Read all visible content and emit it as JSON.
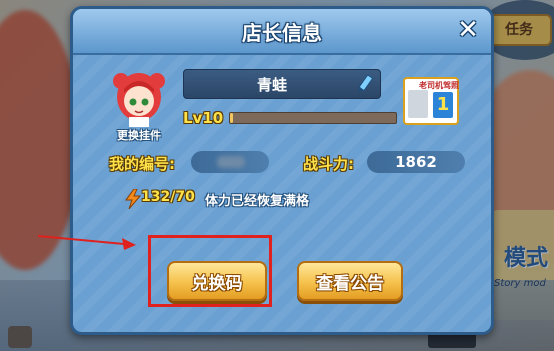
{
  "dialog": {
    "title": "店长信息",
    "close_symbol": "✕"
  },
  "profile": {
    "avatar_icon": "chibi-girl-avatar-icon",
    "change_pendant_label": "更换挂件",
    "name": "青蛙",
    "level_label": "Lv10",
    "xp_progress_fraction": 0.02,
    "license_title": "老司机驾照",
    "license_number": "1"
  },
  "stats": {
    "id_label": "我的编号:",
    "power_label": "战斗力:",
    "power_value": "1862",
    "stamina_value": "132/70",
    "stamina_status": "体力已经恢复满格"
  },
  "buttons": {
    "redeem_label": "兑换码",
    "notice_label": "查看公告"
  },
  "background": {
    "badge_text": "任务",
    "big_text": "模式",
    "small_text": "Story mod"
  },
  "colors": {
    "panel": "#6aa1d2",
    "gold_text": "#ffe24a",
    "button": "#f5c14b",
    "highlight": "#e0211e"
  }
}
